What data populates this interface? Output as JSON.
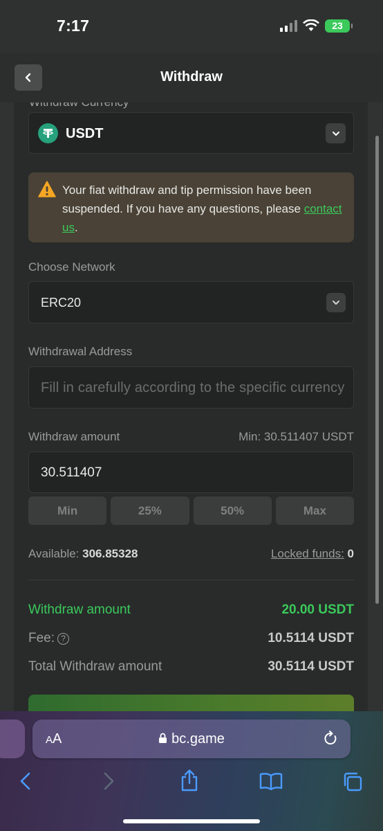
{
  "status": {
    "time": "7:17",
    "battery": "23"
  },
  "header": {
    "title": "Withdraw"
  },
  "currency": {
    "label": "Withdraw Currency",
    "value": "USDT"
  },
  "notice": {
    "text_before": "Your fiat withdraw and tip permission have been suspended. If you have any questions, please ",
    "link": "contact us",
    "text_after": "."
  },
  "network": {
    "label": "Choose Network",
    "value": "ERC20"
  },
  "address": {
    "label": "Withdrawal Address",
    "placeholder": "Fill in carefully according to the specific currency"
  },
  "amount": {
    "label": "Withdraw amount",
    "min_note": "Min: 30.511407 USDT",
    "value": "30.511407",
    "quick": [
      "Min",
      "25%",
      "50%",
      "Max"
    ]
  },
  "balance": {
    "available_label": "Available:",
    "available_value": "306.85328",
    "locked_label": "Locked funds:",
    "locked_value": "0"
  },
  "summary": {
    "withdraw_label": "Withdraw amount",
    "withdraw_value": "20.00 USDT",
    "fee_label": "Fee:",
    "fee_value": "10.5114 USDT",
    "total_label": "Total Withdraw amount",
    "total_value": "30.5114 USDT"
  },
  "browser": {
    "url": "bc.game",
    "aa": "AA"
  },
  "colors": {
    "accent": "#3bc95b",
    "panel": "#282b2a",
    "notice": "#4a4236"
  }
}
